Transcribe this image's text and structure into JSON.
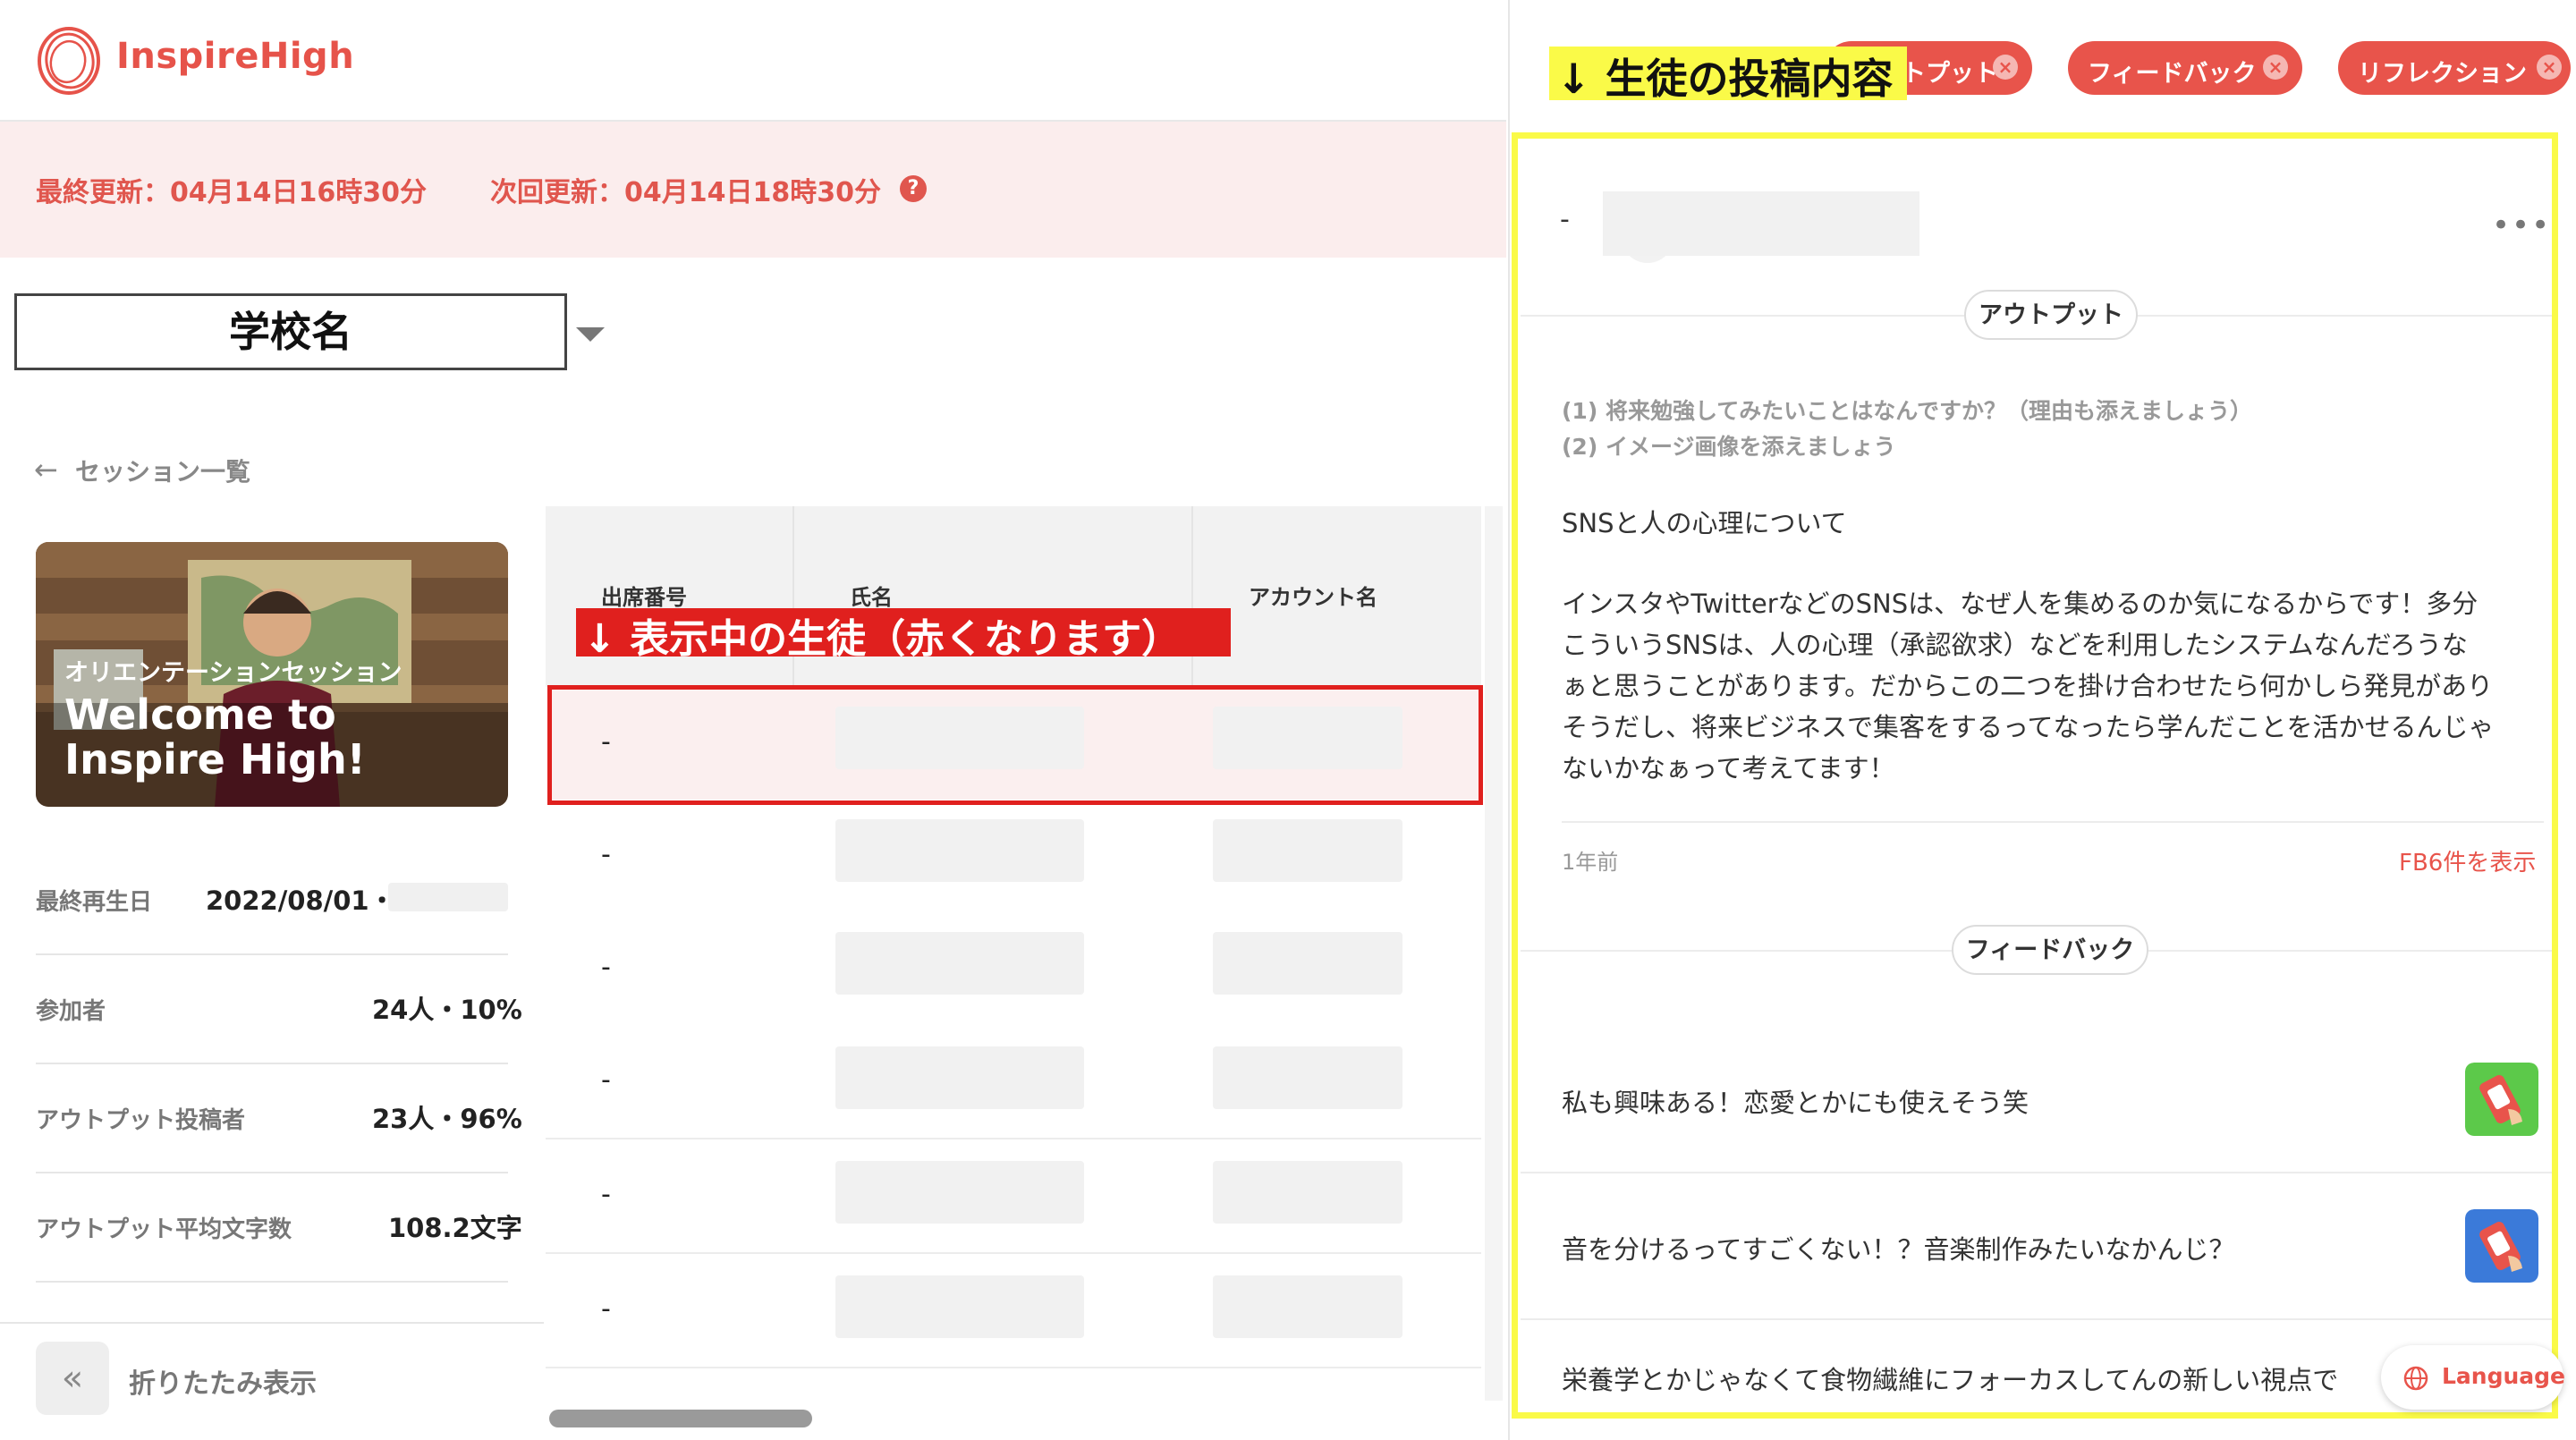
{
  "header": {
    "logo_text": "InspireHigh",
    "last_update": "最終更新：04月14日16時30分",
    "next_update": "次回更新：04月14日18時30分",
    "help_glyph": "?"
  },
  "school_select": {
    "value": "学校名"
  },
  "back_link": {
    "arrow": "←",
    "label": "セッション一覧"
  },
  "session_card": {
    "subtitle": "オリエンテーションセッション",
    "title_line1": "Welcome to",
    "title_line2": "Inspire High!"
  },
  "stats": [
    {
      "label": "最終再生日",
      "value": "2022/08/01・"
    },
    {
      "label": "参加者",
      "value": "24人・10%"
    },
    {
      "label": "アウトプット投稿者",
      "value": "23人・96%"
    },
    {
      "label": "アウトプット平均文字数",
      "value": "108.2文字"
    }
  ],
  "collapse": {
    "icon": "«",
    "label": "折りたたみ表示"
  },
  "table": {
    "headers": [
      "出席番号",
      "氏名",
      "アカウント名"
    ],
    "rows": [
      {
        "number": "-"
      },
      {
        "number": "-"
      },
      {
        "number": "-"
      },
      {
        "number": "-"
      },
      {
        "number": "-"
      },
      {
        "number": "-"
      }
    ]
  },
  "annotations": {
    "rows_note": "↓ 表示中の生徒（赤くなります）",
    "posts_note": "↓ 生徒の投稿内容",
    "highlight_color": "#e0201e",
    "posts_color": "#fafa48"
  },
  "filters": [
    {
      "label": "アウトプット"
    },
    {
      "label": "フィードバック"
    },
    {
      "label": "リフレクション"
    }
  ],
  "filter_close_glyph": "×",
  "post": {
    "author_dash": "-",
    "more_glyph": "•••",
    "section_output": "アウトプット",
    "questions": [
      "(1) 将来勉強してみたいことはなんですか？（理由も添えましょう）",
      "(2) イメージ画像を添えましょう"
    ],
    "answer_title": "SNSと人の心理について",
    "answer_lines": [
      "インスタやTwitterなどのSNSは、なぜ人を集めるのか気になるからです！多分",
      "こういうSNSは、人の心理（承認欲求）などを利用したシステムなんだろうな",
      "ぁと思うことがあります。だからこの二つを掛け合わせたら何かしら発見があり",
      "そうだし、将来ビジネスで集客をするってなったら学んだことを活かせるんじゃ",
      "ないかなぁって考えてます！"
    ],
    "time_ago": "1年前",
    "fb_link": "FB6件を表示",
    "section_feedback": "フィードバック",
    "feedbacks": [
      {
        "text": "私も興味ある！恋愛とかにも使えそう笑"
      },
      {
        "text": "音を分けるってすごくない！？音楽制作みたいなかんじ？"
      },
      {
        "text": "栄養学とかじゃなくて食物繊維にフォーカスしてんの新しい視点で"
      }
    ]
  },
  "language": {
    "label": "Language"
  },
  "colors": {
    "brand": "#e8544b",
    "update_bg": "#fbeded"
  }
}
